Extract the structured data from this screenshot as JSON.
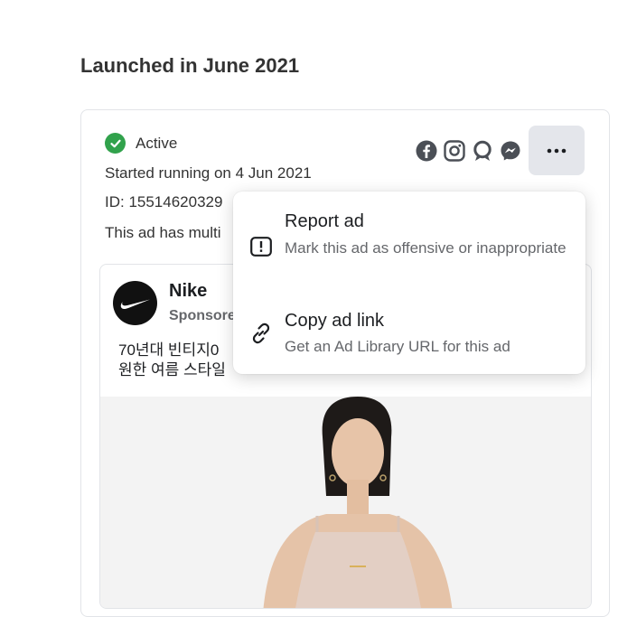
{
  "section": {
    "title": "Launched in June 2021"
  },
  "ad": {
    "status": "Active",
    "started": "Started running on 4 Jun 2021",
    "id_line": "ID: 15514620329",
    "multi_line": "This ad has multi",
    "platforms": [
      "facebook-icon",
      "instagram-icon",
      "audience-network-icon",
      "messenger-icon"
    ],
    "more_label": "···"
  },
  "preview": {
    "advertiser": "Nike",
    "sponsored": "Sponsore",
    "body_line1": "70년대 빈티지0",
    "body_line2": "원한 여름 스타일"
  },
  "menu": {
    "items": [
      {
        "title": "Report ad",
        "subtitle": "Mark this ad as offensive or inappropriate",
        "icon": "report-icon"
      },
      {
        "title": "Copy ad link",
        "subtitle": "Get an Ad Library URL for this ad",
        "icon": "link-icon"
      }
    ]
  },
  "colors": {
    "active_green": "#31a24c",
    "secondary_text": "#65676b",
    "button_bg": "#e4e6eb"
  }
}
